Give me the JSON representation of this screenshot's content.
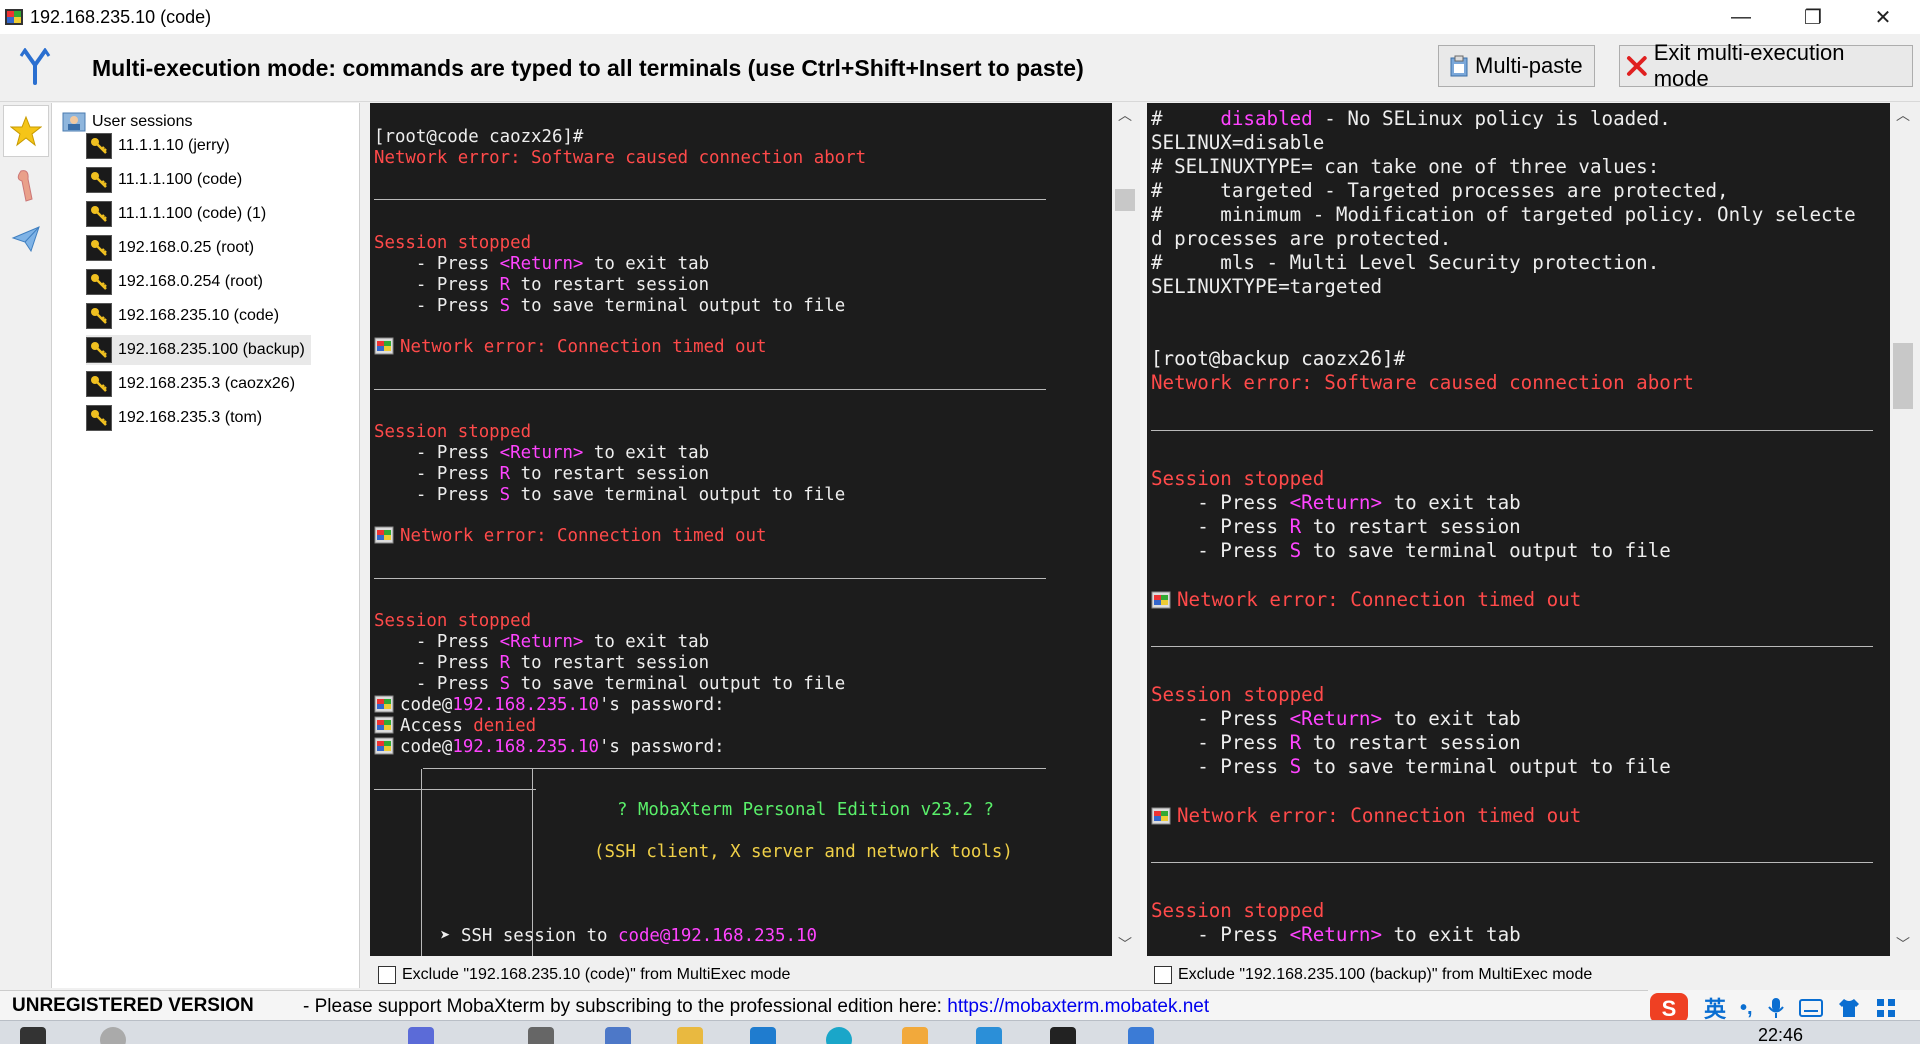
{
  "window": {
    "title": "192.168.235.10 (code)",
    "minimize": "—",
    "maximize": "❐",
    "close": "✕"
  },
  "banner": {
    "text": "Multi-execution mode: commands are typed to all terminals (use Ctrl+Shift+Insert to paste)",
    "multipaste_label": "Multi-paste",
    "exit_label": "Exit multi-execution mode"
  },
  "sidebar": {
    "root_label": "User sessions",
    "items": [
      {
        "label": "11.1.1.10 (jerry)"
      },
      {
        "label": "11.1.1.100 (code)"
      },
      {
        "label": "11.1.1.100 (code) (1)"
      },
      {
        "label": "192.168.0.25 (root)"
      },
      {
        "label": "192.168.0.254 (root)"
      },
      {
        "label": "192.168.235.10 (code)"
      },
      {
        "label": "192.168.235.100 (backup)",
        "selected": true
      },
      {
        "label": "192.168.235.3 (caozx26)"
      },
      {
        "label": "192.168.235.3 (tom)"
      }
    ]
  },
  "left_terminal": {
    "prompt": "[root@code caozx26]#",
    "abort_msg": "Network error: Software caused connection abort",
    "session_stopped": "Session stopped",
    "press": "    - Press ",
    "return_key": "<Return>",
    "to_exit_tab": " to exit tab",
    "r_key": "R",
    "to_restart": " to restart session",
    "s_key": "S",
    "to_save": " to save terminal output to file",
    "timed_out_msg": "Network error: Connection timed out",
    "pw_user": "code@",
    "pw_host": "192.168.235.10",
    "pw_suffix": "'s password:",
    "access": "Access ",
    "denied": "denied",
    "banner_line1": "? MobaXterm Personal Edition v23.2 ?",
    "banner_line2": "(SSH client, X server and network tools)",
    "ssh_prefix": "➤ SSH session to ",
    "ssh_target": "code@192.168.235.10",
    "exclude_label": "Exclude \"192.168.235.10 (code)\" from MultiExec mode"
  },
  "right_terminal": {
    "l1_hash": "#     ",
    "l1_disabled": "disabled",
    "l1_rest": " - No SELinux policy is loaded.",
    "l2": "SELINUX=disable",
    "l3": "# SELINUXTYPE= can take one of three values:",
    "l4": "#     targeted - Targeted processes are protected,",
    "l5": "#     minimum - Modification of targeted policy. Only selecte",
    "l6": "d processes are protected.",
    "l7": "#     mls - Multi Level Security protection.",
    "l8": "SELINUXTYPE=targeted",
    "prompt": "[root@backup caozx26]#",
    "exclude_label": "Exclude \"192.168.235.100 (backup)\" from MultiExec mode"
  },
  "statusbar": {
    "unregistered": "UNREGISTERED VERSION",
    "support_text": " -  Please support MobaXterm by subscribing to the professional edition here:  ",
    "support_link": "https://mobaxterm.mobatek.net",
    "ime_lang": "英",
    "ime_punct": "•,"
  },
  "taskbar": {
    "clock": "22:46"
  },
  "colors": {
    "terminal_bg": "#1c1c1c",
    "error_red": "#ff4a4a",
    "key_magenta": "#ff44ff",
    "banner_green": "#5af06a",
    "banner_yellow": "#f0d048",
    "exit_x_red": "#e02020"
  }
}
